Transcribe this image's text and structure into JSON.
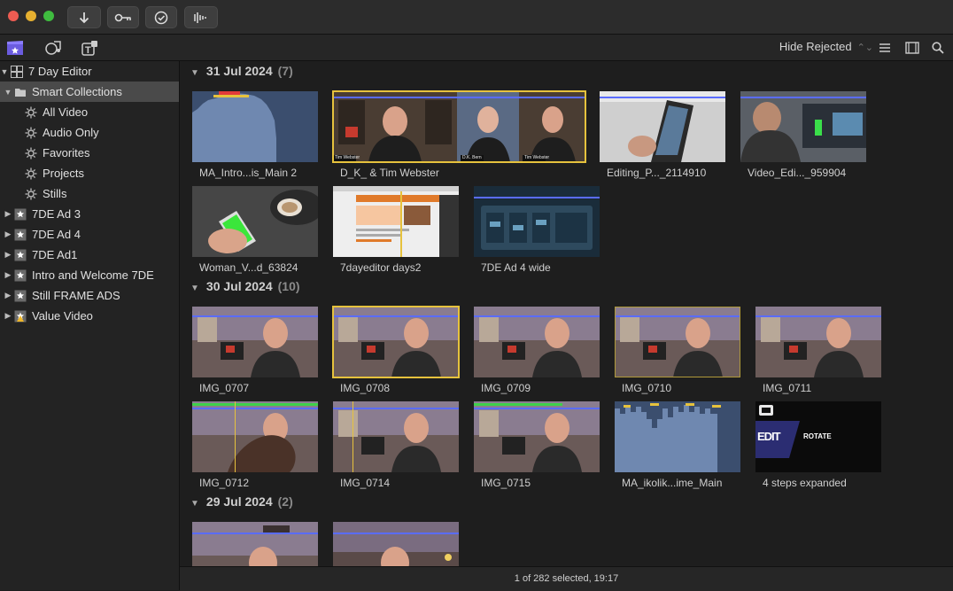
{
  "titlebar": {
    "buttons": [
      {
        "name": "import-button",
        "icon": "arrow-down-icon"
      },
      {
        "name": "keyword-button",
        "icon": "key-icon"
      },
      {
        "name": "background-tasks-button",
        "icon": "check-circle-icon"
      },
      {
        "name": "audio-button",
        "icon": "waveform-icon"
      }
    ]
  },
  "browser_toolbar": {
    "filter_label": "Hide Rejected",
    "filter_chevron": "⌃⌄"
  },
  "sidebar": {
    "library": "7 Day Editor",
    "smart_collections": "Smart Collections",
    "smart_items": [
      "All Video",
      "Audio Only",
      "Favorites",
      "Projects",
      "Stills"
    ],
    "events": [
      "7DE Ad 3",
      "7DE Ad 4",
      "7DE Ad1",
      "Intro and Welcome 7DE",
      "Still FRAME ADS",
      "Value Video"
    ]
  },
  "groups": [
    {
      "date": "31 Jul 2024",
      "count": "(7)",
      "clips": [
        "MA_Intro...is_Main 2",
        "D_K_ & Tim Webster",
        "Editing_P..._2114910",
        "Video_Edi..._959904",
        "Woman_V...d_63824",
        "7dayeditor days2",
        "7DE Ad 4 wide"
      ]
    },
    {
      "date": "30 Jul 2024",
      "count": "(10)",
      "clips": [
        "IMG_0707",
        "IMG_0708",
        "IMG_0709",
        "IMG_0710",
        "IMG_0711",
        "IMG_0712",
        "IMG_0714",
        "IMG_0715",
        "MA_ikolik...ime_Main",
        "4 steps expanded"
      ]
    },
    {
      "date": "29 Jul 2024",
      "count": "(2)",
      "clips": []
    }
  ],
  "thumb_text": {
    "tim_label": "Tim Webster",
    "dk_label": "D.K. Bern",
    "edit": "EDIT",
    "rotate": "ROTATE"
  },
  "status": "1 of 282 selected, 19:17",
  "colors": {
    "selection": "#e6c23d",
    "range": "#5a6cff",
    "favorite": "#3fd04a",
    "reject": "#e23a3a"
  }
}
